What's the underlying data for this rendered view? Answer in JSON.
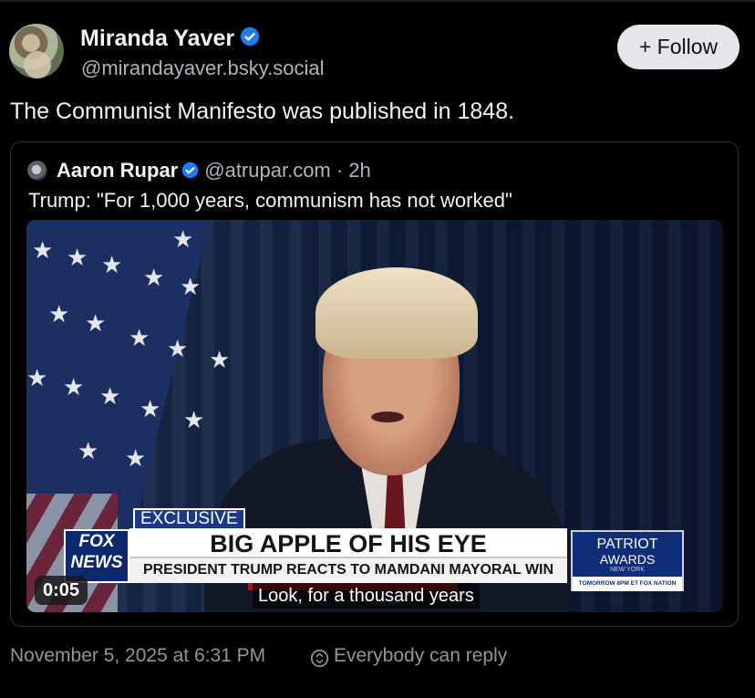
{
  "post": {
    "author": {
      "display_name": "Miranda Yaver",
      "handle": "@mirandayaver.bsky.social",
      "verified": true
    },
    "follow_label": "+ Follow",
    "text": "The Communist Manifesto was published in 1848.",
    "quoted_post": {
      "author_name": "Aaron Rupar",
      "verified": true,
      "handle_time": "@atrupar.com · 2h",
      "text": "Trump: \"For 1,000 years, communism has not worked\"",
      "video": {
        "chyron": {
          "tag": "EXCLUSIVE",
          "headline": "BIG APPLE OF HIS EYE",
          "subline": "PRESIDENT TRUMP REACTS TO MAMDANI MAYORAL WIN",
          "network_logo_top": "FOX",
          "network_logo_bottom": "NEWS",
          "promo_title": "PATRIOT",
          "promo_sub": "AWARDS",
          "promo_city": "NEW YORK",
          "promo_footer": "TOMORROW 8PM ET FOX NATION"
        },
        "timestamp": "0:05",
        "caption": "Look, for a thousand years"
      }
    },
    "date": "November 5, 2025 at 6:31 PM",
    "reply_setting": "Everybody can reply"
  },
  "colors": {
    "background": "#000000",
    "verified_badge": "#1f7bf2",
    "secondary_text": "#aeb5bd",
    "follow_button_bg": "#e4e6ea"
  }
}
